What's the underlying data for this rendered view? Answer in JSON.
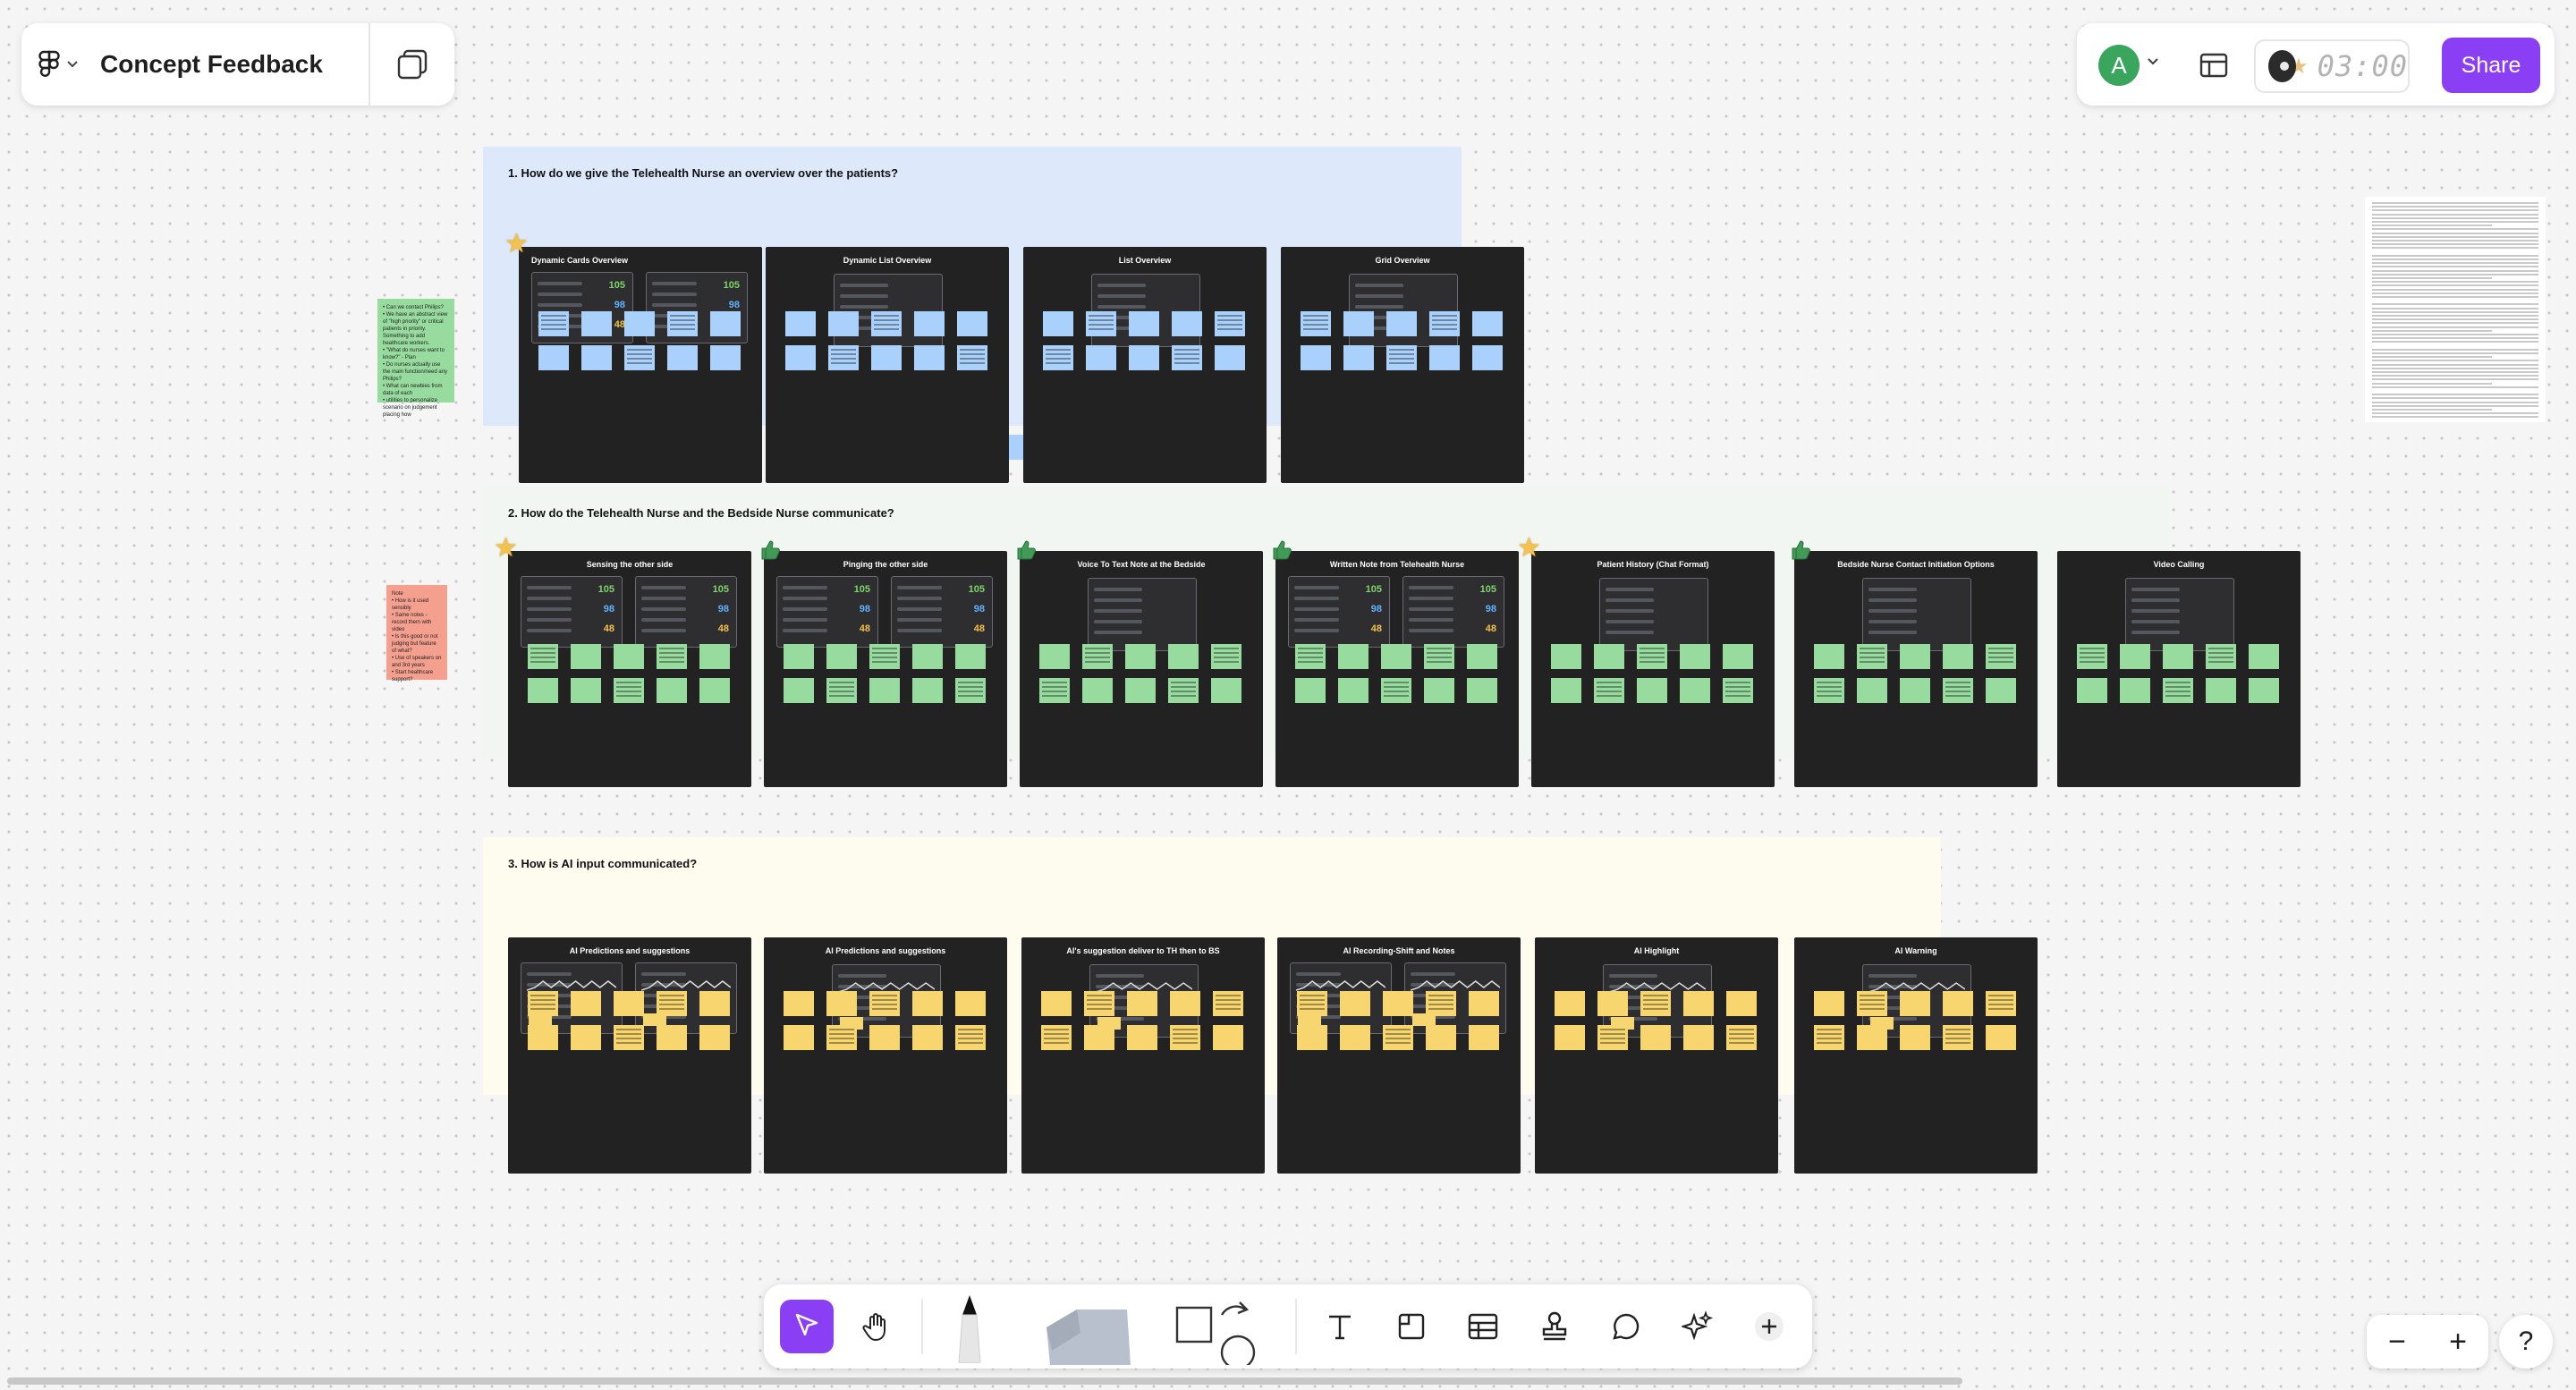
{
  "app": {
    "file_name": "Concept Feedback"
  },
  "header": {
    "avatar_initial": "A",
    "timer": "03:00",
    "share_label": "Share"
  },
  "sections": [
    {
      "title": "1. How do we give the Telehealth Nurse an overview over the patients?",
      "color": "#dde9fb",
      "note_color": "#a9d1fb",
      "cards": [
        {
          "title": "Dynamic Cards Overview",
          "sticker": "star"
        },
        {
          "title": "Dynamic List Overview",
          "sticker": ""
        },
        {
          "title": "List Overview",
          "sticker": ""
        },
        {
          "title": "Grid Overview",
          "sticker": ""
        }
      ]
    },
    {
      "title": "2. How do the Telehealth Nurse and the Bedside Nurse communicate?",
      "color": "#f2f6f3",
      "note_color": "#97dc9e",
      "cards": [
        {
          "title": "Sensing the other side",
          "sticker": "star"
        },
        {
          "title": "Pinging the other side",
          "sticker": "thumb"
        },
        {
          "title": "Voice To Text Note at the Bedside",
          "sticker": "thumb"
        },
        {
          "title": "Written Note from Telehealth Nurse",
          "sticker": "thumb"
        },
        {
          "title": "Patient History (Chat Format)",
          "sticker": "star"
        },
        {
          "title": "Bedside Nurse Contact Initiation Options",
          "sticker": "thumb"
        },
        {
          "title": "Video Calling",
          "sticker": ""
        }
      ]
    },
    {
      "title": "3. How is AI input communicated?",
      "color": "#fefcef",
      "note_color": "#f8d66f",
      "cards": [
        {
          "title": "AI Predictions and suggestions",
          "sticker": ""
        },
        {
          "title": "AI Predictions and suggestions",
          "sticker": ""
        },
        {
          "title": "AI's suggestion deliver to TH then to BS",
          "sticker": ""
        },
        {
          "title": "AI Recording-Shift and Notes",
          "sticker": ""
        },
        {
          "title": "AI Highlight",
          "sticker": ""
        },
        {
          "title": "AI Warning",
          "sticker": ""
        }
      ]
    }
  ],
  "vitals": {
    "hr": "105",
    "spo2": "98",
    "rr": "48"
  },
  "side_notes": [
    {
      "color": "#97dc9e",
      "text": "• Can we contact Philips?\n• We have an abstract view of \"high priority\" or critical patients in priority. Something to add healthcare workers.\n• \"What do nurses want to know?\" - Plan\n• Do nurses actually use the main function/need any Philips?\n• What can newbies from data of each\n• utilities to personalize scenario on judgement placing how"
    },
    {
      "color": "#f5a08e",
      "text": "Note\n• How is it used sensibly\n• Same notes - record them with video\n• Is this good or not judging but feature of what?\n• Use of speakers on and 3rd years\n• Start healthcare support?"
    }
  ],
  "toolbar": {
    "tools": [
      "move-tool",
      "hand-tool",
      "pen-tool",
      "marker-tool",
      "shape-tool",
      "text-tool",
      "section-tool",
      "table-tool",
      "stamp-tool",
      "comment-tool",
      "ai-tool",
      "more-tool"
    ]
  },
  "zoom": {
    "minus": "−",
    "plus": "+"
  },
  "help_label": "?"
}
